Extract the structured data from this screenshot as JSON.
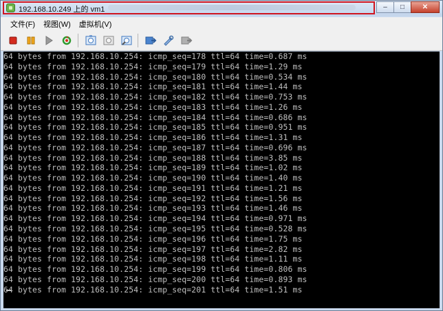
{
  "window": {
    "title": "192.168.10.249 上的 vm1",
    "min_label": "–",
    "max_label": "□",
    "close_label": "✕"
  },
  "menu": [
    {
      "label": "文件(F)"
    },
    {
      "label": "视图(W)"
    },
    {
      "label": "虚拟机(V)"
    }
  ],
  "toolbar_icons": [
    "stop-icon",
    "pause-icon",
    "play-icon",
    "reset-icon",
    "snapshot-icon",
    "revert-snapshot-icon",
    "manage-snapshot-icon",
    "connect-device-icon",
    "edit-settings-icon",
    "disconnect-device-icon"
  ],
  "colors": {
    "terminal_bg": "#000000",
    "terminal_fg": "#c0c0c0",
    "title_highlight": "#d0141e"
  },
  "terminal_lines": [
    "64 bytes from 192.168.10.254: icmp_seq=178 ttl=64 time=0.687 ms",
    "64 bytes from 192.168.10.254: icmp_seq=179 ttl=64 time=1.29 ms",
    "64 bytes from 192.168.10.254: icmp_seq=180 ttl=64 time=0.534 ms",
    "64 bytes from 192.168.10.254: icmp_seq=181 ttl=64 time=1.44 ms",
    "64 bytes from 192.168.10.254: icmp_seq=182 ttl=64 time=0.753 ms",
    "64 bytes from 192.168.10.254: icmp_seq=183 ttl=64 time=1.26 ms",
    "64 bytes from 192.168.10.254: icmp_seq=184 ttl=64 time=0.686 ms",
    "64 bytes from 192.168.10.254: icmp_seq=185 ttl=64 time=0.951 ms",
    "64 bytes from 192.168.10.254: icmp_seq=186 ttl=64 time=1.31 ms",
    "64 bytes from 192.168.10.254: icmp_seq=187 ttl=64 time=0.696 ms",
    "64 bytes from 192.168.10.254: icmp_seq=188 ttl=64 time=3.85 ms",
    "64 bytes from 192.168.10.254: icmp_seq=189 ttl=64 time=1.02 ms",
    "64 bytes from 192.168.10.254: icmp_seq=190 ttl=64 time=1.40 ms",
    "64 bytes from 192.168.10.254: icmp_seq=191 ttl=64 time=1.21 ms",
    "64 bytes from 192.168.10.254: icmp_seq=192 ttl=64 time=1.56 ms",
    "64 bytes from 192.168.10.254: icmp_seq=193 ttl=64 time=1.46 ms",
    "64 bytes from 192.168.10.254: icmp_seq=194 ttl=64 time=0.971 ms",
    "64 bytes from 192.168.10.254: icmp_seq=195 ttl=64 time=0.528 ms",
    "64 bytes from 192.168.10.254: icmp_seq=196 ttl=64 time=1.75 ms",
    "64 bytes from 192.168.10.254: icmp_seq=197 ttl=64 time=2.82 ms",
    "64 bytes from 192.168.10.254: icmp_seq=198 ttl=64 time=1.11 ms",
    "64 bytes from 192.168.10.254: icmp_seq=199 ttl=64 time=0.806 ms",
    "64 bytes from 192.168.10.254: icmp_seq=200 ttl=64 time=0.893 ms",
    "64 bytes from 192.168.10.254: icmp_seq=201 ttl=64 time=1.51 ms"
  ]
}
